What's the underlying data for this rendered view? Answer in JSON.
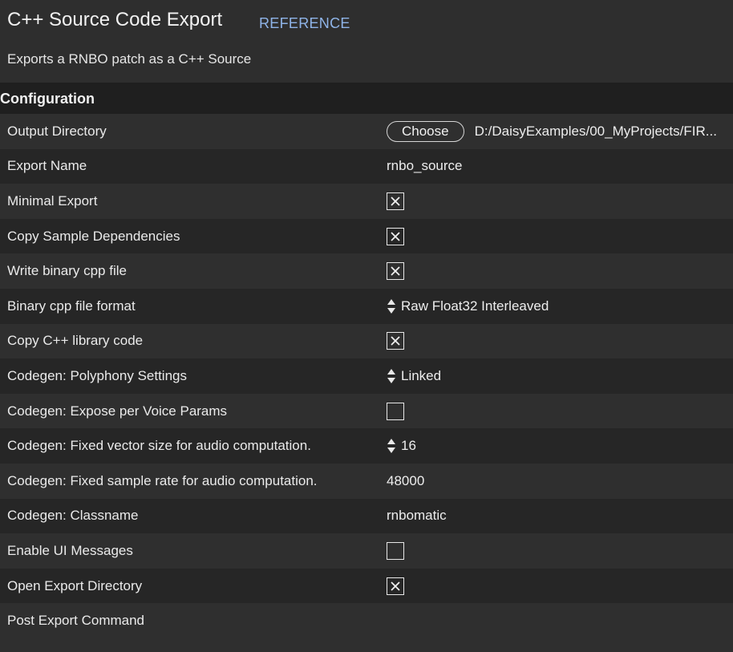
{
  "header": {
    "title": "C++ Source Code Export",
    "reference_link": "REFERENCE",
    "description": "Exports a RNBO patch as a C++ Source"
  },
  "section": {
    "title": "Configuration"
  },
  "rows": [
    {
      "label": "Output Directory",
      "type": "directory",
      "button_label": "Choose",
      "value": "D:/DaisyExamples/00_MyProjects/FIR..."
    },
    {
      "label": "Export Name",
      "type": "text",
      "value": "rnbo_source"
    },
    {
      "label": "Minimal Export",
      "type": "checkbox",
      "checked": true
    },
    {
      "label": "Copy Sample Dependencies",
      "type": "checkbox",
      "checked": true
    },
    {
      "label": "Write binary cpp file",
      "type": "checkbox",
      "checked": true
    },
    {
      "label": "Binary cpp file format",
      "type": "select",
      "value": "Raw Float32 Interleaved"
    },
    {
      "label": "Copy C++ library code",
      "type": "checkbox",
      "checked": true
    },
    {
      "label": "Codegen: Polyphony Settings",
      "type": "select",
      "value": "Linked"
    },
    {
      "label": "Codegen: Expose per Voice Params",
      "type": "checkbox",
      "checked": false
    },
    {
      "label": "Codegen: Fixed vector size for audio computation.",
      "type": "select",
      "value": "16"
    },
    {
      "label": "Codegen: Fixed sample rate for audio computation.",
      "type": "text",
      "value": "48000"
    },
    {
      "label": "Codegen: Classname",
      "type": "text",
      "value": "rnbomatic"
    },
    {
      "label": "Enable UI Messages",
      "type": "checkbox",
      "checked": false
    },
    {
      "label": "Open Export Directory",
      "type": "checkbox",
      "checked": true
    },
    {
      "label": "Post Export Command",
      "type": "text",
      "value": ""
    }
  ],
  "icons": {
    "check": "x-mark-icon",
    "stepper": "up-down-arrows-icon"
  },
  "colors": {
    "background": "#2d2d2d",
    "section_header": "#1f1f1f",
    "row_odd": "#2f2f2f",
    "row_even": "#262626",
    "link": "#8fb4e8"
  }
}
